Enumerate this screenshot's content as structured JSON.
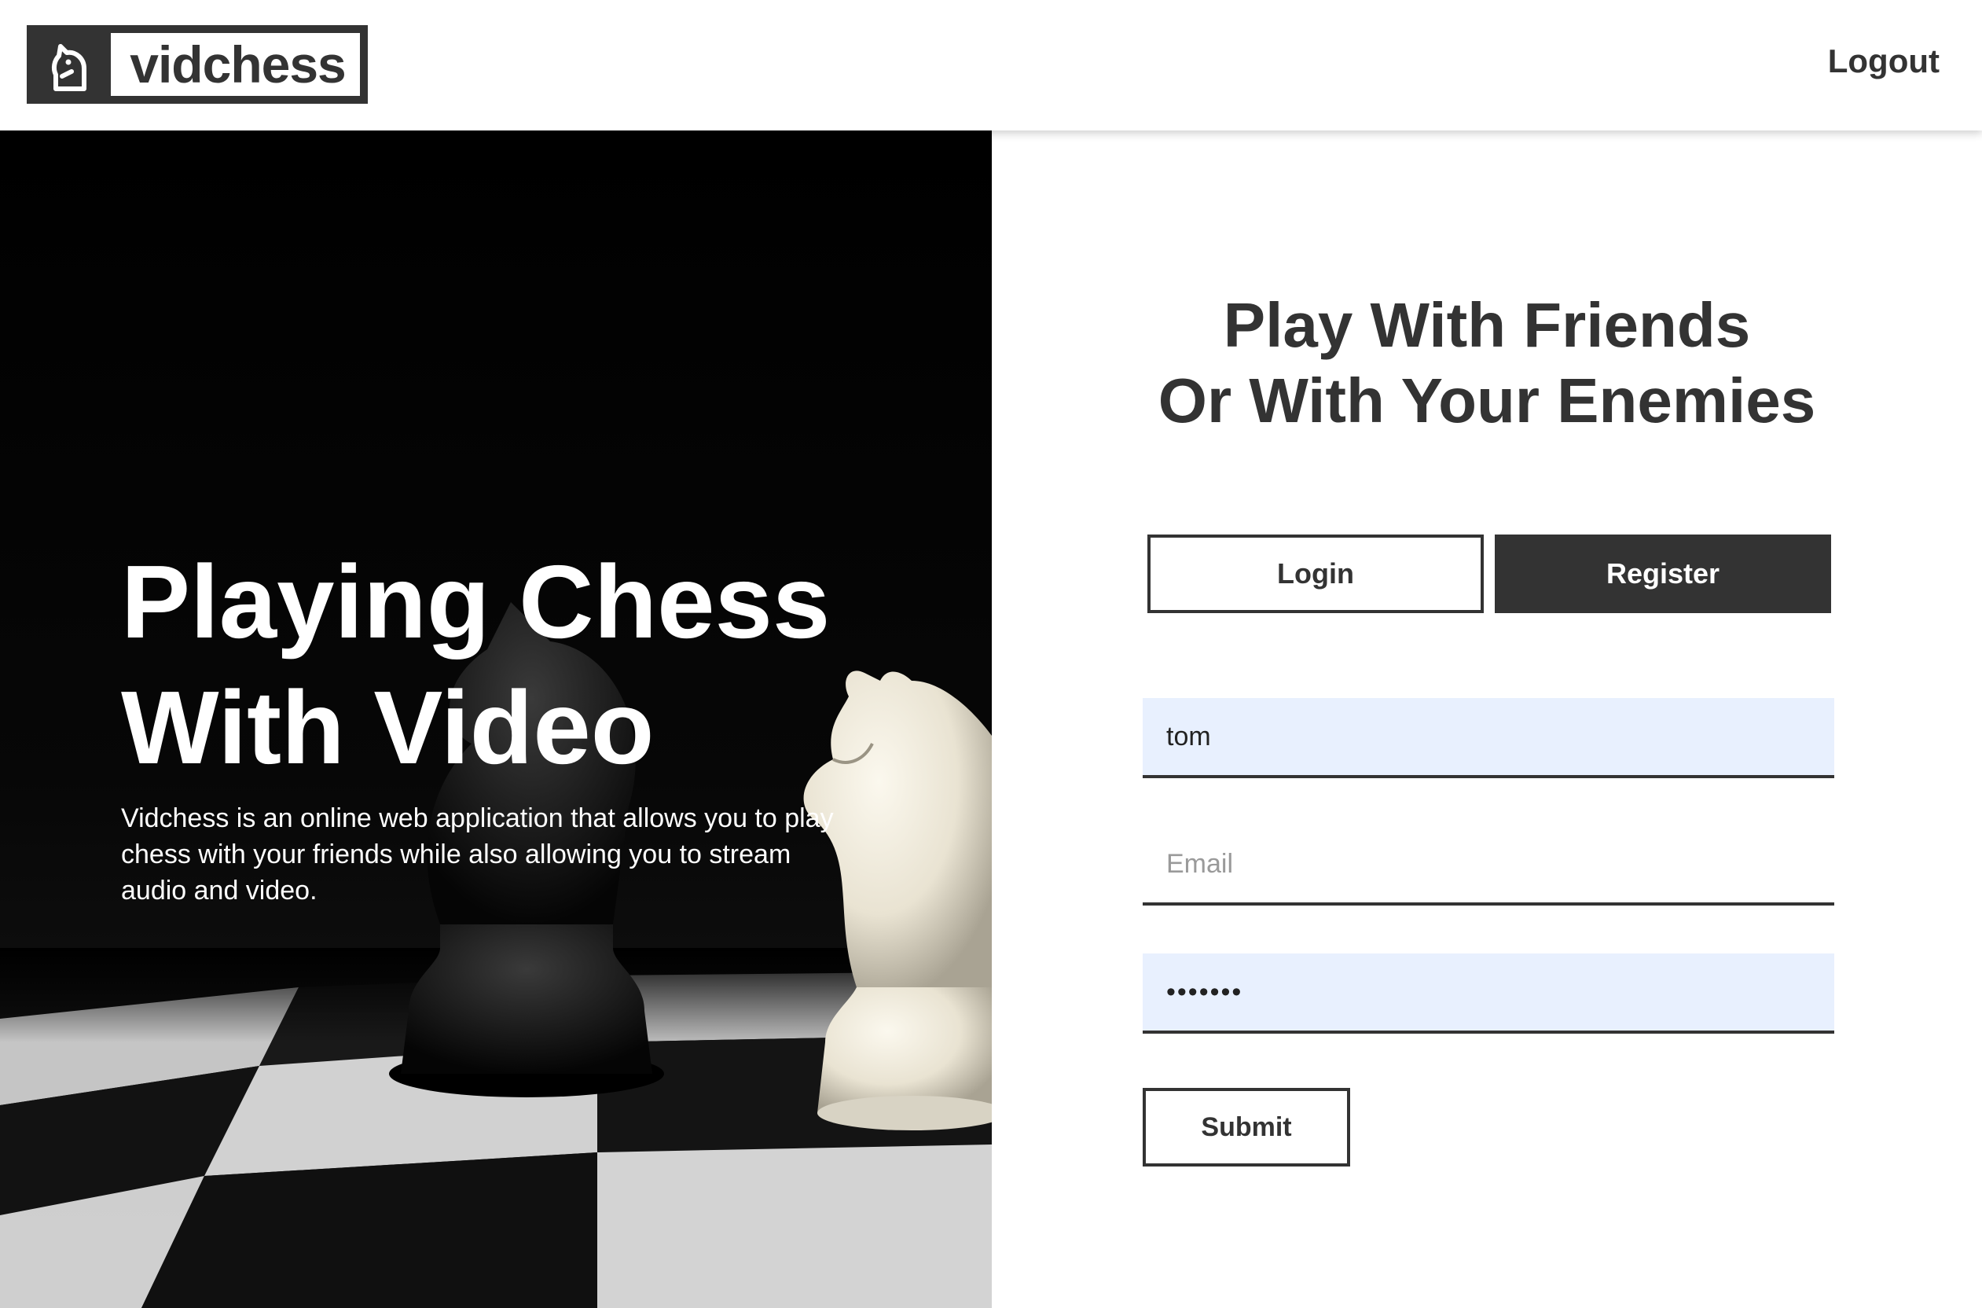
{
  "header": {
    "logo_text": "vidchess",
    "logout_label": "Logout"
  },
  "hero": {
    "title": "Playing Chess\nWith Video",
    "description": "Vidchess is an online web application that allows you to play chess with your friends while also allowing you to stream audio and video."
  },
  "panel": {
    "heading_line1": "Play With Friends",
    "heading_line2": "Or With Your Enemies",
    "tabs": [
      {
        "label": "Login",
        "active": false
      },
      {
        "label": "Register",
        "active": true
      }
    ],
    "fields": {
      "username_value": "tom",
      "email_placeholder": "Email",
      "password_value": "•••••••"
    },
    "submit_label": "Submit"
  },
  "colors": {
    "primary": "#333333",
    "autofill": "#e8f0fe",
    "background": "#ffffff"
  }
}
